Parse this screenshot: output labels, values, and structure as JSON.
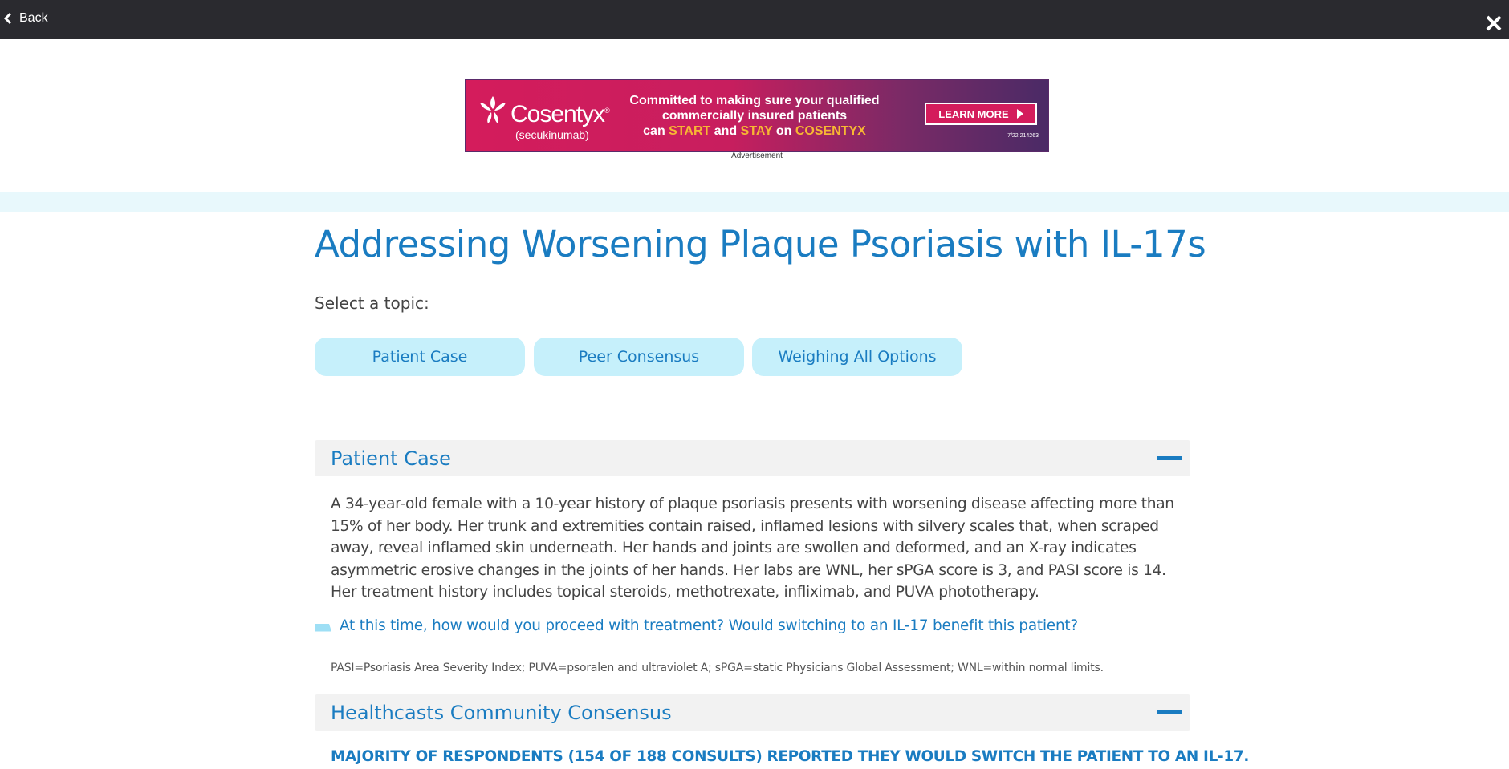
{
  "topbar": {
    "back_label": "Back"
  },
  "ad": {
    "brand": "Cosentyx",
    "registered": "®",
    "generic": "(secukinumab)",
    "line1": "Committed to making sure your qualified",
    "line2": "commercially insured patients",
    "line3_a": "can ",
    "line3_start": "START",
    "line3_b": " and ",
    "line3_stay": "STAY",
    "line3_c": " on ",
    "line3_brand": "COSENTYX",
    "cta": "LEARN MORE",
    "code": "7/22 214263",
    "label": "Advertisement"
  },
  "page": {
    "title": "Addressing Worsening Plaque Psoriasis with IL-17s",
    "topic_prompt": "Select a topic:",
    "topics": [
      "Patient Case",
      "Peer Consensus",
      "Weighing All Options"
    ]
  },
  "patient_case": {
    "heading": "Patient Case",
    "text": "A 34-year-old female with a 10-year history of plaque psoriasis presents with worsening disease affecting more than 15% of her body. Her trunk and extremities contain raised, inflamed lesions with silvery scales that, when scraped away, reveal inflamed skin underneath. Her hands and joints are swollen and deformed, and an X-ray indicates asymmetric erosive changes in the joints of her hands. Her labs are WNL, her sPGA score is 3, and PASI score is 14. Her treatment history includes topical steroids, methotrexate, infliximab, and PUVA phototherapy.",
    "question": "At this time, how would you proceed with treatment? Would switching to an IL-17 benefit this patient?",
    "abbreviations": "PASI=Psoriasis Area Severity Index; PUVA=psoralen and ultraviolet A; sPGA=static Physicians Global Assessment; WNL=within normal limits."
  },
  "community": {
    "heading": "Healthcasts Community Consensus",
    "summary": "MAJORITY OF RESPONDENTS (154 OF 188 CONSULTS) REPORTED THEY WOULD SWITCH THE PATIENT TO AN IL-17."
  }
}
